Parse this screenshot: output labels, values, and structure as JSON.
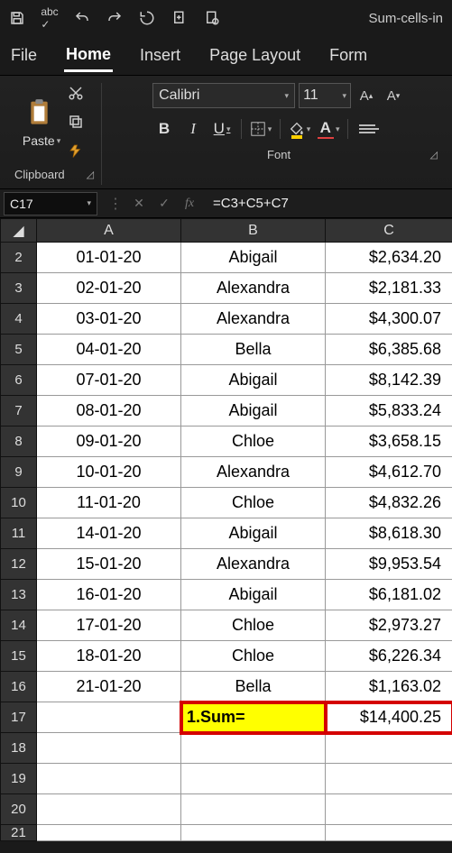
{
  "titlebar": {
    "workbook_name": "Sum-cells-in"
  },
  "tabs": {
    "file": "File",
    "home": "Home",
    "insert": "Insert",
    "page_layout": "Page Layout",
    "formulas": "Form"
  },
  "ribbon": {
    "clipboard": {
      "paste": "Paste",
      "label": "Clipboard"
    },
    "font": {
      "name": "Calibri",
      "size": "11",
      "bold": "B",
      "italic": "I",
      "underline": "U",
      "font_color_letter": "A",
      "label": "Font"
    }
  },
  "fxbar": {
    "cell_ref": "C17",
    "fx_label": "fx",
    "formula": "=C3+C5+C7"
  },
  "grid": {
    "col_headers": [
      "A",
      "B",
      "C"
    ],
    "rows": [
      {
        "n": "2",
        "a": "01-01-20",
        "b": "Abigail",
        "c": "$2,634.20"
      },
      {
        "n": "3",
        "a": "02-01-20",
        "b": "Alexandra",
        "c": "$2,181.33"
      },
      {
        "n": "4",
        "a": "03-01-20",
        "b": "Alexandra",
        "c": "$4,300.07"
      },
      {
        "n": "5",
        "a": "04-01-20",
        "b": "Bella",
        "c": "$6,385.68"
      },
      {
        "n": "6",
        "a": "07-01-20",
        "b": "Abigail",
        "c": "$8,142.39"
      },
      {
        "n": "7",
        "a": "08-01-20",
        "b": "Abigail",
        "c": "$5,833.24"
      },
      {
        "n": "8",
        "a": "09-01-20",
        "b": "Chloe",
        "c": "$3,658.15"
      },
      {
        "n": "9",
        "a": "10-01-20",
        "b": "Alexandra",
        "c": "$4,612.70"
      },
      {
        "n": "10",
        "a": "11-01-20",
        "b": "Chloe",
        "c": "$4,832.26"
      },
      {
        "n": "11",
        "a": "14-01-20",
        "b": "Abigail",
        "c": "$8,618.30"
      },
      {
        "n": "12",
        "a": "15-01-20",
        "b": "Alexandra",
        "c": "$9,953.54"
      },
      {
        "n": "13",
        "a": "16-01-20",
        "b": "Abigail",
        "c": "$6,181.02"
      },
      {
        "n": "14",
        "a": "17-01-20",
        "b": "Chloe",
        "c": "$2,973.27"
      },
      {
        "n": "15",
        "a": "18-01-20",
        "b": "Chloe",
        "c": "$6,226.34"
      },
      {
        "n": "16",
        "a": "21-01-20",
        "b": "Bella",
        "c": "$1,163.02"
      }
    ],
    "sum_row": {
      "n": "17",
      "b": "1.Sum=",
      "c": "$14,400.25"
    },
    "empty_rows": [
      "18",
      "19",
      "20"
    ],
    "cut_row": "21"
  }
}
